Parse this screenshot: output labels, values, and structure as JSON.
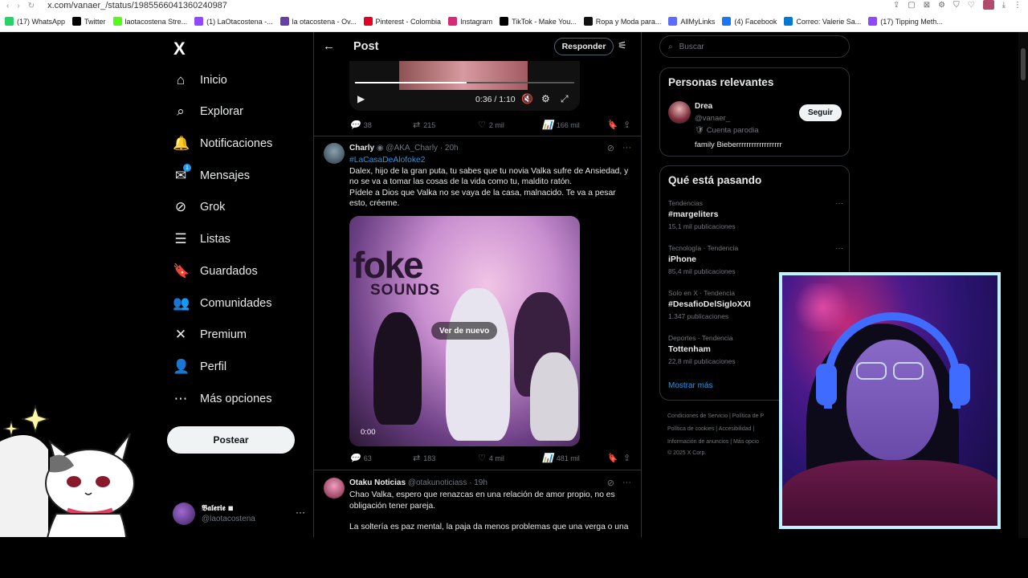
{
  "browser": {
    "url": "x.com/vanaer_/status/1985566041360240987",
    "bookmarks": [
      {
        "label": "(17) WhatsApp",
        "color": "#25d366"
      },
      {
        "label": "Twitter",
        "color": "#000000"
      },
      {
        "label": "laotacostena Stre...",
        "color": "#53fc18"
      },
      {
        "label": "(1) LaOtacostena -...",
        "color": "#9146ff"
      },
      {
        "label": "la otacostena - Ov...",
        "color": "#6441a5"
      },
      {
        "label": "Pinterest - Colombia",
        "color": "#e60023"
      },
      {
        "label": "Instagram",
        "color": "#d62976"
      },
      {
        "label": "TikTok - Make You...",
        "color": "#000000"
      },
      {
        "label": "Ropa y Moda para...",
        "color": "#111111"
      },
      {
        "label": "AllMyLinks",
        "color": "#5b6cff"
      },
      {
        "label": "(4) Facebook",
        "color": "#1877f2"
      },
      {
        "label": "Correo: Valerie Sa...",
        "color": "#0078d4"
      },
      {
        "label": "(17) Tipping Meth...",
        "color": "#9146ff"
      }
    ]
  },
  "sidebar": {
    "logo": "X",
    "items": [
      {
        "label": "Inicio",
        "icon": "home-icon"
      },
      {
        "label": "Explorar",
        "icon": "search-icon"
      },
      {
        "label": "Notificaciones",
        "icon": "bell-icon"
      },
      {
        "label": "Mensajes",
        "icon": "mail-icon",
        "badge": "1"
      },
      {
        "label": "Grok",
        "icon": "grok-icon"
      },
      {
        "label": "Listas",
        "icon": "list-icon"
      },
      {
        "label": "Guardados",
        "icon": "bookmark-icon"
      },
      {
        "label": "Comunidades",
        "icon": "communities-icon"
      },
      {
        "label": "Premium",
        "icon": "x-icon"
      },
      {
        "label": "Perfil",
        "icon": "profile-icon"
      },
      {
        "label": "Más opciones",
        "icon": "more-circle-icon"
      }
    ],
    "post_button": "Postear",
    "account": {
      "name": "𝕭𝖆𝖑𝖊𝖗𝖎𝖊 ◾",
      "handle": "@laotacostena",
      "more": "···"
    }
  },
  "main": {
    "title": "Post",
    "reply_button": "Responder",
    "top_video": {
      "time": "0:36 / 1:10",
      "progress": 0.51
    },
    "top_actions": {
      "replies": "38",
      "reposts": "215",
      "likes": "2 mil",
      "views": "166 mil"
    },
    "tweets": [
      {
        "name": "Charly",
        "handle": "@AKA_Charly · 20h",
        "hashtag": "#LaCasaDeAlofoke2",
        "text": "Dalex, hijo de la gran puta, tu sabes que tu novia Valka sufre de Ansiedad, y no se va a tomar las cosas de la vida como tu, maldito ratón.\nPídele a Dios que Valka no se vaya de la casa, malnacido. Te va a pesar esto, créeme.",
        "video": {
          "logo": "foke",
          "logo_sub": "SOUNDS",
          "button": "Ver de nuevo",
          "time": "0:00"
        },
        "actions": {
          "replies": "63",
          "reposts": "183",
          "likes": "4 mil",
          "views": "481 mil"
        }
      },
      {
        "name": "Otaku Noticias",
        "handle": "@otakunoticiass · 19h",
        "text": "Chao Valka, espero que renazcas en una relación de amor propio, no es obligación tener pareja.",
        "text2": "La soltería es paz mental, la paja da menos problemas que una verga o una"
      }
    ]
  },
  "right": {
    "search_placeholder": "Buscar",
    "relevant": {
      "title": "Personas relevantes",
      "name": "Drea",
      "handle": "@vanaer_",
      "parody": "🛡 Cuenta parodia",
      "bio": "family Bieberrrrrrrrrrrrrrrrrr",
      "follow": "Seguir"
    },
    "trending": {
      "title": "Qué está pasando",
      "items": [
        {
          "context": "Tendencias",
          "name": "#margeliters",
          "count": "15,1 mil publicaciones"
        },
        {
          "context": "Tecnología · Tendencia",
          "name": "iPhone",
          "count": "85,4 mil publicaciones"
        },
        {
          "context": "Solo en X · Tendencia",
          "name": "#DesafioDelSigloXXI",
          "count": "1.347 publicaciones"
        },
        {
          "context": "Deportes · Tendencia",
          "name": "Tottenham",
          "count": "22,8 mil publicaciones"
        }
      ],
      "show_more": "Mostrar más"
    },
    "footer": {
      "line1": "Condiciones de Servicio  |  Política de P",
      "line2": "Política de cookies  |  Accesibilidad  |",
      "line3": "Información de anuncios  |  Más opcio",
      "line4": "© 2025 X Corp."
    }
  }
}
